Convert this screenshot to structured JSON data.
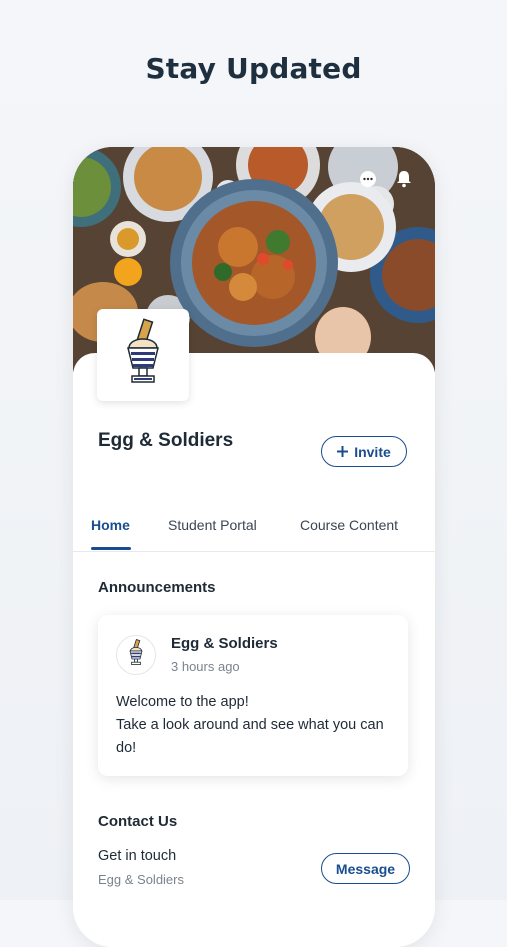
{
  "headline": "Stay Updated",
  "site": {
    "name": "Egg & Soldiers",
    "invite_label": "Invite"
  },
  "tabs": [
    {
      "label": "Home",
      "active": true
    },
    {
      "label": "Student Portal",
      "active": false
    },
    {
      "label": "Course Content",
      "active": false
    }
  ],
  "announcements": {
    "title": "Announcements",
    "post": {
      "author": "Egg & Soldiers",
      "time": "3 hours ago",
      "body_line1": "Welcome to the app!",
      "body_line2": "Take a look around and see what you can do!"
    }
  },
  "contact": {
    "title": "Contact Us",
    "line1": "Get in touch",
    "line2": "Egg & Soldiers",
    "message_label": "Message"
  },
  "icons": [
    "chat-icon",
    "bell-icon",
    "plus-icon",
    "egg-cup-logo-icon"
  ],
  "colors": {
    "accent": "#1a4d8f",
    "text": "#1e2a36",
    "muted": "#7a838e"
  }
}
